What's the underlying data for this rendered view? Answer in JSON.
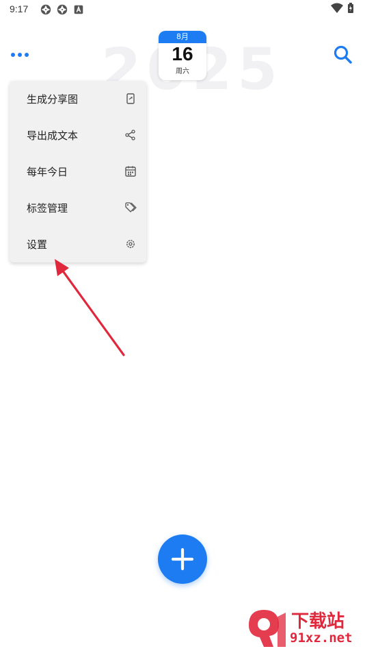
{
  "status_bar": {
    "time": "9:17"
  },
  "header": {
    "year_watermark": "2025",
    "calendar": {
      "month": "8月",
      "day": "16",
      "weekday": "周六"
    }
  },
  "menu": {
    "items": [
      {
        "label": "生成分享图",
        "icon": "share-image-icon"
      },
      {
        "label": "导出成文本",
        "icon": "share-icon"
      },
      {
        "label": "每年今日",
        "icon": "calendar-icon"
      },
      {
        "label": "标签管理",
        "icon": "tag-icon"
      },
      {
        "label": "设置",
        "icon": "gear-icon"
      }
    ]
  },
  "watermark": {
    "title": "下载站",
    "domain": "91xz.net"
  },
  "colors": {
    "accent": "#1e7cf2",
    "annotation": "#e0283c"
  }
}
